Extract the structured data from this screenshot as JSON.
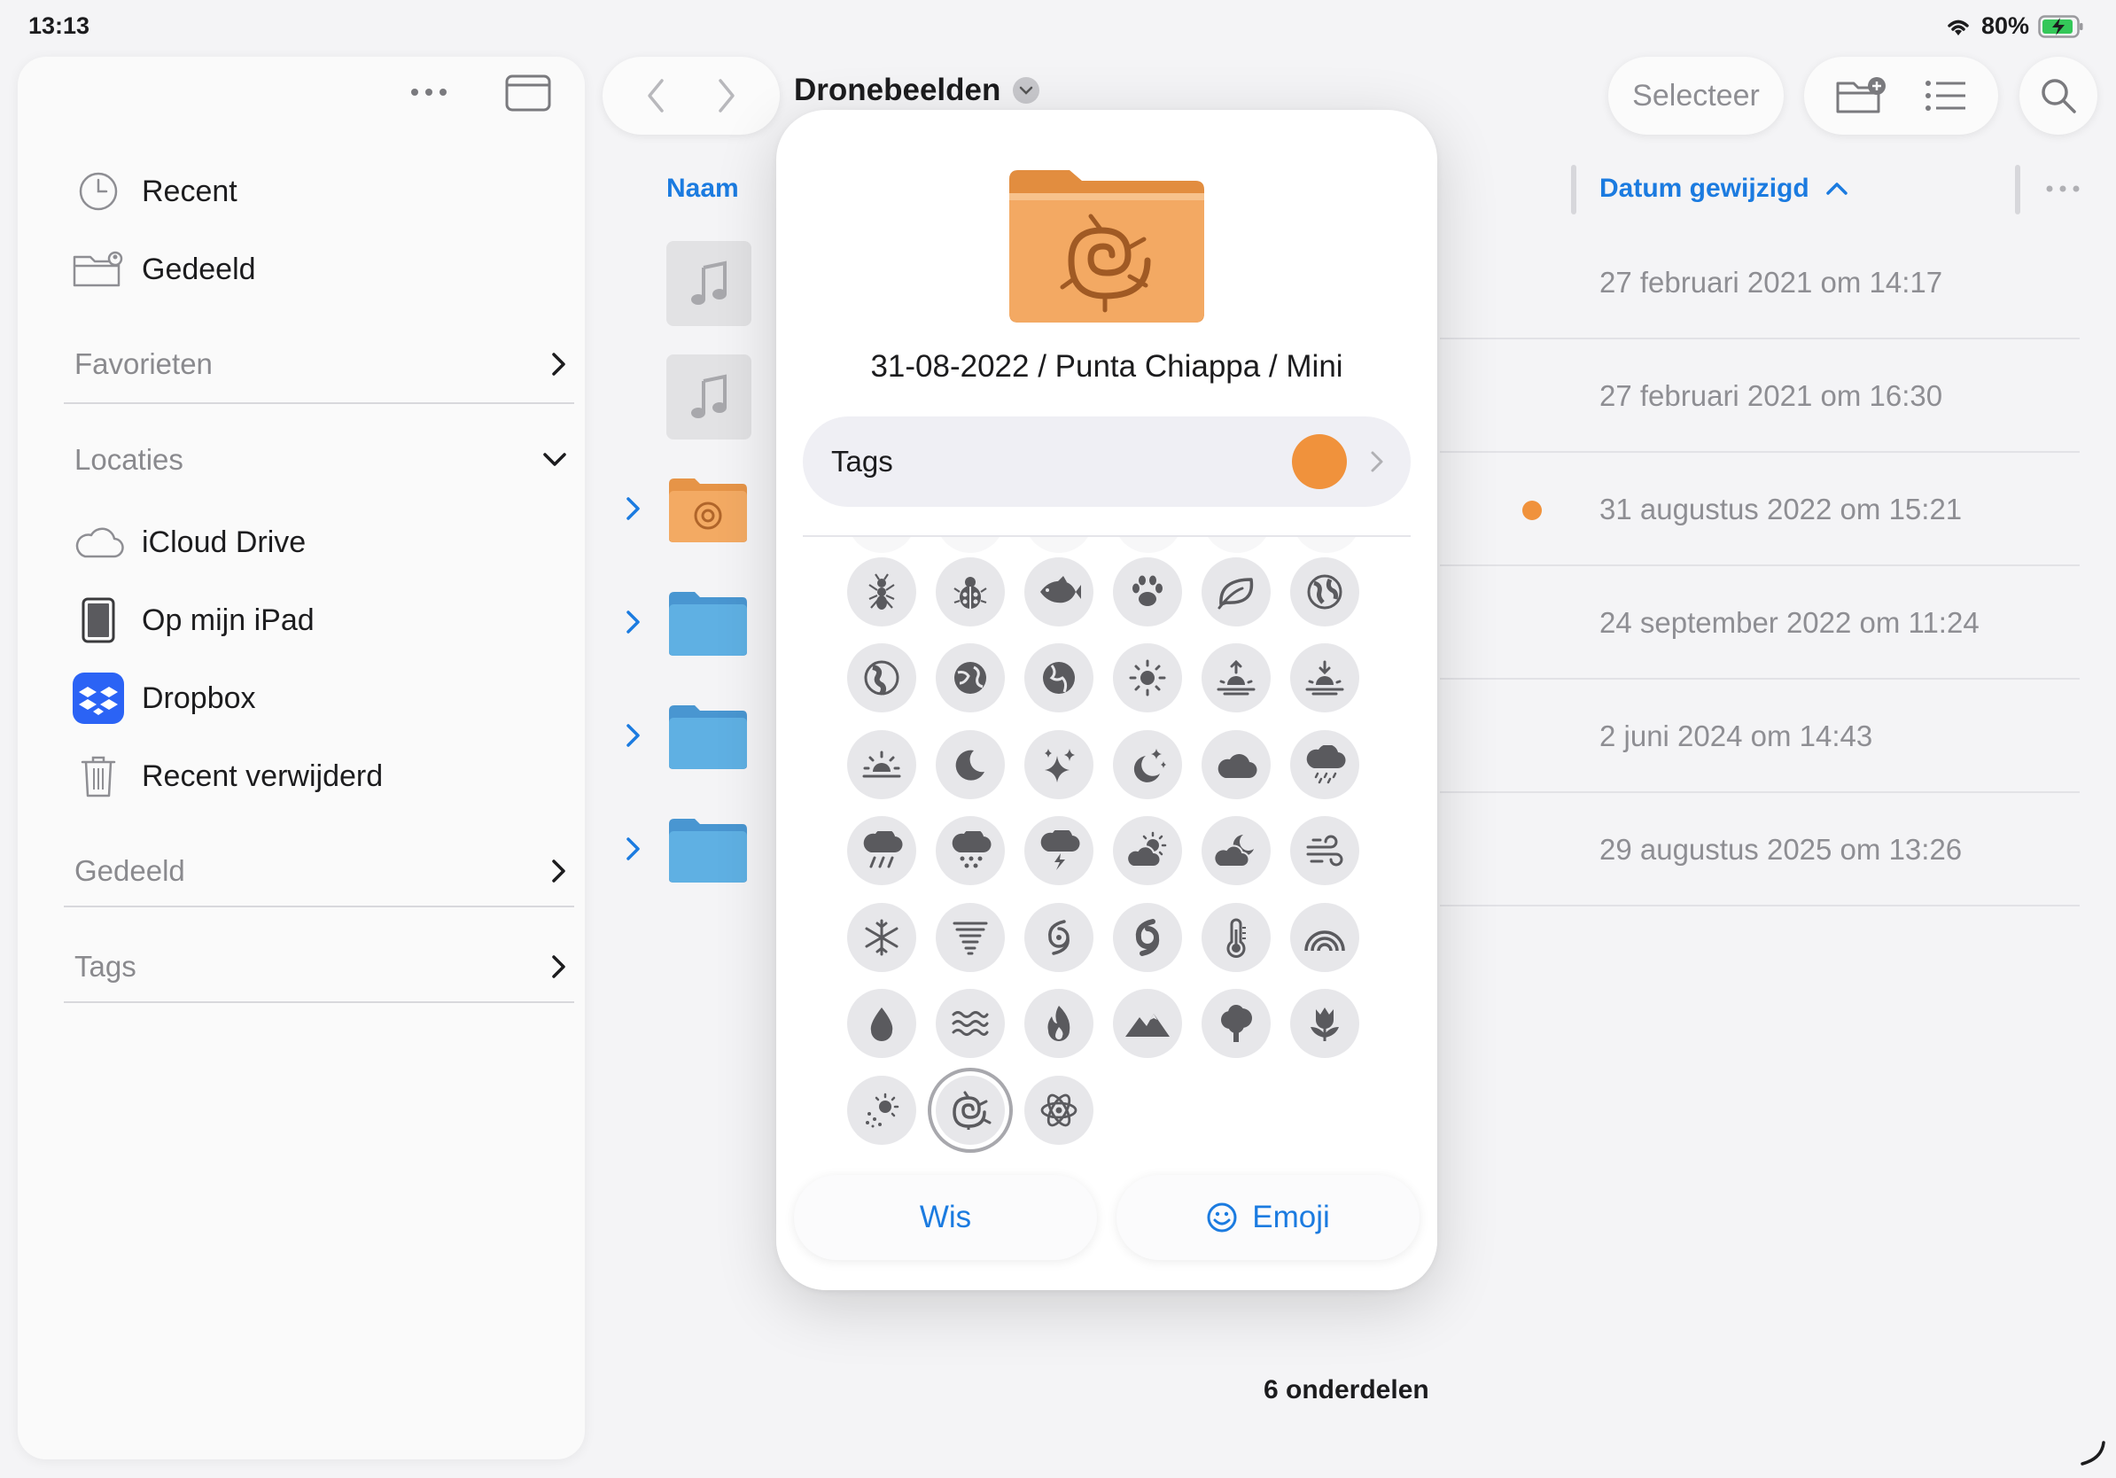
{
  "status": {
    "time": "13:13",
    "battery": "80%"
  },
  "sidebar": {
    "top_items": [
      {
        "label": "Recent",
        "icon": "clock-icon"
      },
      {
        "label": "Gedeeld",
        "icon": "shared-folder-icon"
      }
    ],
    "favorites": "Favorieten",
    "locations": {
      "heading": "Locaties",
      "items": [
        {
          "label": "iCloud Drive",
          "icon": "cloud-icon"
        },
        {
          "label": "Op mijn iPad",
          "icon": "ipad-icon"
        },
        {
          "label": "Dropbox",
          "icon": "dropbox-icon"
        },
        {
          "label": "Recent verwijderd",
          "icon": "trash-icon"
        }
      ]
    },
    "shared": "Gedeeld",
    "tags": "Tags"
  },
  "toolbar": {
    "title": "Dronebeelden",
    "select": "Selecteer"
  },
  "list": {
    "col_name": "Naam",
    "col_date": "Datum gewijzigd",
    "rows": [
      {
        "date": "27 februari 2021 om 14:17",
        "kind": "audio"
      },
      {
        "date": "27 februari 2021 om 16:30",
        "kind": "audio"
      },
      {
        "date": "31 augustus 2022 om 15:21",
        "kind": "folder-orange",
        "tag": "orange"
      },
      {
        "date": "24 september 2022 om 11:24",
        "kind": "folder-blue"
      },
      {
        "date": "2 juni 2024 om 14:43",
        "kind": "folder-blue"
      },
      {
        "date": "29 augustus 2025 om 13:26",
        "kind": "folder-blue"
      }
    ],
    "footer": "6 onderdelen"
  },
  "popover": {
    "folder_name": "31-08-2022 / Punta Chiappa / Mini",
    "tags_label": "Tags",
    "tag_color": "#f0923c",
    "icons": [
      [
        "ant-icon",
        "ladybug-icon",
        "fish-icon",
        "pawprint-icon",
        "leaf-icon",
        "globe-icon"
      ],
      [
        "globe-americas-icon",
        "globe-asia-icon",
        "globe-europe-icon",
        "sun-icon",
        "sunrise-icon",
        "sunset-icon"
      ],
      [
        "sun-horizon-icon",
        "moon-icon",
        "sparkles-icon",
        "moon-stars-icon",
        "cloud-icon",
        "cloud-drizzle-icon"
      ],
      [
        "cloud-rain-icon",
        "cloud-snow-icon",
        "cloud-bolt-icon",
        "cloud-sun-icon",
        "cloud-moon-icon",
        "wind-icon"
      ],
      [
        "snowflake-icon",
        "tornado-icon",
        "hurricane-icon",
        "hurricane-filled-icon",
        "thermometer-icon",
        "rainbow-icon"
      ],
      [
        "drop-icon",
        "water-waves-icon",
        "flame-icon",
        "mountains-icon",
        "tree-icon",
        "tulip-icon"
      ],
      [
        "sun-dust-icon",
        "nautilus-icon",
        "atom-icon"
      ]
    ],
    "selected_icon": "nautilus-icon",
    "clear_label": "Wis",
    "emoji_label": "Emoji"
  },
  "colors": {
    "accent": "#1b7be0",
    "folder_blue": "#5aa9de",
    "folder_orange": "#f0a45c",
    "tag_orange": "#f0923c"
  }
}
